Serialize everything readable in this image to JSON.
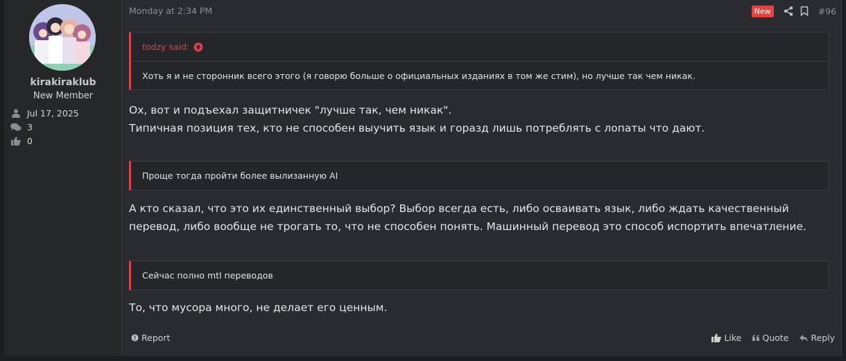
{
  "user": {
    "name": "kirakiraklub",
    "title": "New Member",
    "joined": "Jul 17, 2025",
    "messages": "3",
    "reactions": "0"
  },
  "post": {
    "time": "Monday at 2:34 PM",
    "badge": "New",
    "number": "#96",
    "quote1": {
      "author": "todzy said:",
      "text": "Хоть я и не сторонник всего этого (я говорю больше о официальных изданиях в том же стим), но лучше так чем никак."
    },
    "reply1_line1": "Ох, вот и подъехал защитничек \"лучше так, чем никак\".",
    "reply1_line2": "Типичная позиция тех, кто не способен выучить язык и горазд лишь потреблять с лопаты что дают.",
    "quote2": {
      "text": "Проще тогда пройти более вылизанную AI"
    },
    "reply2_line1": "А кто сказал, что это их единственный выбор? Выбор всегда есть, либо осваивать язык, либо ждать качественный",
    "reply2_line2": "перевод, либо вообще не трогать то, что не способен понять. Машинный перевод это способ испортить впечатление.",
    "quote3": {
      "text": "Сейчас полно mtl переводов"
    },
    "reply3": "То, что мусора много, не делает его ценным."
  },
  "actions": {
    "report": "Report",
    "like": "Like",
    "quote": "Quote",
    "reply": "Reply"
  },
  "colors": {
    "accent": "#d9414b",
    "badge": "#e2443f",
    "background": "#2a2b30"
  }
}
